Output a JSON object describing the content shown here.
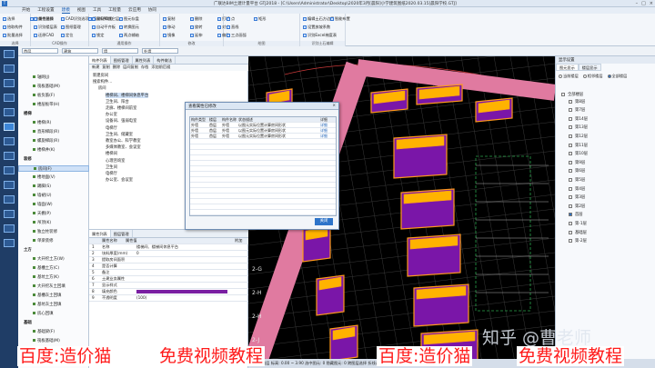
{
  "window": {
    "title": "广联达BIM土建计量平台 GTJ2018 - [C:\\Users\\Administrator\\Desktop\\2020年3月[晨阳]小学建筑图纸2020.03.15]晨阳学校.GTJ]",
    "controls": [
      "–",
      "□",
      "×"
    ]
  },
  "menu": [
    "开始",
    "工程设置",
    "建模",
    "视图",
    "工具",
    "工程量",
    "云应用",
    "协同"
  ],
  "menu_active": 2,
  "ribbon": {
    "groups": [
      {
        "label": "选择",
        "items": [
          "选择",
          "拾取构件",
          "批量选择",
          "按属性选择"
        ]
      },
      {
        "label": "CAD操作",
        "items": [
          "查找替换",
          "识别楼层表",
          "还原CAD",
          "CAD识别选项",
          "图纸管理",
          "定位",
          "清除CAD图"
        ]
      },
      {
        "label": "通用操作",
        "items": [
          "复制到其它层",
          "自动平齐板",
          "锁定",
          "图元存盘",
          "转换图元",
          "两点辅轴"
        ]
      },
      {
        "label": "修改",
        "items": [
          "复制",
          "移动",
          "镜像",
          "删除",
          "旋转",
          "延伸",
          "打断",
          "对齐",
          "偏移"
        ]
      },
      {
        "label": "绘图",
        "items": [
          "点",
          "直线",
          "三点画弧",
          "矩形"
        ]
      },
      {
        "label": "识别土石编辑",
        "items": [
          "编辑土石方边界",
          "设置放坡系数",
          "识别Excel梯度表",
          "智能布置"
        ]
      }
    ]
  },
  "layerbar": {
    "floor": "首层",
    "type": "建筑",
    "category": "墙",
    "component": "外墙"
  },
  "nav": {
    "items": [
      {
        "label": "轴网(J)",
        "cat": false
      },
      {
        "label": "筏板基础(M)",
        "cat": false
      },
      {
        "label": "板负筋(F)",
        "cat": false
      },
      {
        "label": "楼层板带(H)",
        "cat": false
      },
      {
        "label": "楼梯",
        "cat": true
      },
      {
        "label": "楼梯(R)",
        "cat": false
      },
      {
        "label": "直形梯段(R)",
        "cat": false
      },
      {
        "label": "螺旋梯段(R)",
        "cat": false
      },
      {
        "label": "楼梯井(K)",
        "cat": false
      },
      {
        "label": "装修",
        "cat": true
      },
      {
        "label": "房间(F)",
        "cat": false,
        "sel": true
      },
      {
        "label": "楼地面(V)",
        "cat": false
      },
      {
        "label": "踢脚(S)",
        "cat": false
      },
      {
        "label": "墙裙(U)",
        "cat": false
      },
      {
        "label": "墙面(W)",
        "cat": false
      },
      {
        "label": "天棚(P)",
        "cat": false
      },
      {
        "label": "吊顶(K)",
        "cat": false
      },
      {
        "label": "独立柱装修",
        "cat": false
      },
      {
        "label": "单梁装修",
        "cat": false
      },
      {
        "label": "土方",
        "cat": true
      },
      {
        "label": "大开挖土方(W)",
        "cat": false
      },
      {
        "label": "基槽土方(C)",
        "cat": false
      },
      {
        "label": "基坑土方(K)",
        "cat": false
      },
      {
        "label": "大开挖灰土回填",
        "cat": false
      },
      {
        "label": "基槽灰土回填",
        "cat": false
      },
      {
        "label": "基坑灰土回填",
        "cat": false
      },
      {
        "label": "房心回填",
        "cat": false
      },
      {
        "label": "基础",
        "cat": true
      },
      {
        "label": "基础梁(F)",
        "cat": false
      },
      {
        "label": "筏板基础(M)",
        "cat": false
      },
      {
        "label": "筏板主筋(R)",
        "cat": false
      },
      {
        "label": "筏板负筋(X)",
        "cat": false
      }
    ]
  },
  "attr": {
    "tabs": [
      "构件列表",
      "图纸管理",
      "属性列表",
      "构件做法"
    ],
    "toolbar": [
      "新建",
      "复制",
      "删除",
      "层间复制",
      "存档",
      "添加前后缀"
    ],
    "tree": [
      "新建房间",
      "搜索构件...",
      "房间",
      "楼梯间、楼梯间休息平台",
      "卫生间、阳台",
      "走廊、楼梯间前室",
      "办公室",
      "设备间、强弱电室",
      "电梯厅",
      "卫生间、储藏室",
      "教室办公、科学教室",
      "多媒体教室、会议室",
      "楼梯间",
      "心理咨询室",
      "卫生间",
      "电梯厅",
      "办公室、会议室"
    ]
  },
  "props": {
    "tabs": [
      "属性列表",
      "图层管理"
    ],
    "header": [
      "",
      "属性名称",
      "属性值",
      "附加"
    ],
    "rows": [
      {
        "n": "1",
        "name": "名称",
        "val": "楼梯间、楼梯间休息平台"
      },
      {
        "n": "2",
        "name": "块料厚度(mm)",
        "val": "0"
      },
      {
        "n": "3",
        "name": "提取房间面积",
        "val": ""
      },
      {
        "n": "4",
        "name": "是否计算",
        "val": ""
      },
      {
        "n": "5",
        "name": "备注",
        "val": ""
      },
      {
        "n": "6",
        "name": "土建业务属性",
        "val": ""
      },
      {
        "n": "7",
        "name": "显示样式",
        "val": ""
      },
      {
        "n": "8",
        "name": "填充颜色",
        "val": ""
      },
      {
        "n": "9",
        "name": "不透明度",
        "val": "(100)"
      }
    ]
  },
  "dialog": {
    "title": "查看属性已修改",
    "columns": [
      "构件类型",
      "楼层",
      "构件名称",
      "状态描述",
      "详细"
    ],
    "rows": [
      [
        "外墙",
        "首层",
        "外墙",
        "以图元实际位置计算房间形状",
        "详细"
      ],
      [
        "外墙",
        "首层",
        "外墙",
        "以图元实际位置计算房间形状",
        "详细"
      ],
      [
        "外墙",
        "首层",
        "外墙",
        "以图元实际位置计算房间形状",
        "详细"
      ]
    ],
    "ok_label": "关闭"
  },
  "rightpanel": {
    "title": "显示设置",
    "tabs": [
      "图元显示",
      "楼层显示"
    ],
    "radios": [
      "当前楼层",
      "相邻楼层",
      "全部楼层"
    ],
    "root": "全部楼层",
    "floors": [
      "第8层",
      "第7层",
      "第14层",
      "第13层",
      "第12层",
      "第11层",
      "第10层",
      "第9层",
      "第6层",
      "第5层",
      "第4层",
      "第3层",
      "第2层",
      "首层",
      "第-1层",
      "基础层",
      "第-2层"
    ]
  },
  "axis_labels": [
    "2-G",
    "2-H",
    "2-H",
    "2-J",
    "2-K"
  ],
  "watermarks": [
    "百度:造价猫",
    "免费视频教程",
    "百度:造价猫",
    "免费视频教程"
  ],
  "zhihu_watermark": "知乎 @曹老师",
  "status": "楼层: 首层  标高: 0.00 ~ 3.90  选中图元: 0  隐藏图元: 0  跨图层选择  折线选择",
  "colors": {
    "accent": "#2b6fc2",
    "watermark_red": "#ff1a1a"
  }
}
